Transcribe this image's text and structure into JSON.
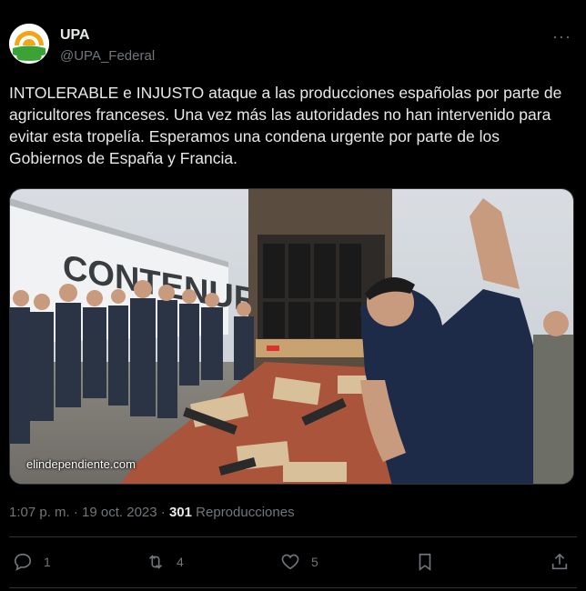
{
  "author": {
    "name": "UPA",
    "handle": "@UPA_Federal",
    "avatar_icon": "sun-over-field-logo"
  },
  "more_label": "···",
  "tweet": {
    "text": "INTOLERABLE e INJUSTO ataque a las producciones españolas por parte de agricultores franceses. Una vez más las autoridades no han intervenido para evitar esta tropelía. Esperamos una condena urgente por parte de los Gobiernos de España y Francia."
  },
  "media": {
    "truck_text": "CONTENUR",
    "watermark": "elindependiente.com"
  },
  "meta": {
    "time": "1:07 p. m.",
    "separator": "·",
    "date": "19 oct. 2023",
    "separator2": "·",
    "views_count": "301",
    "views_label": "Reproducciones"
  },
  "actions": {
    "replies": "1",
    "retweets": "4",
    "likes": "5"
  },
  "colors": {
    "background": "#000000",
    "text": "#e7e9ea",
    "muted": "#71767b",
    "border": "#2f3336"
  }
}
